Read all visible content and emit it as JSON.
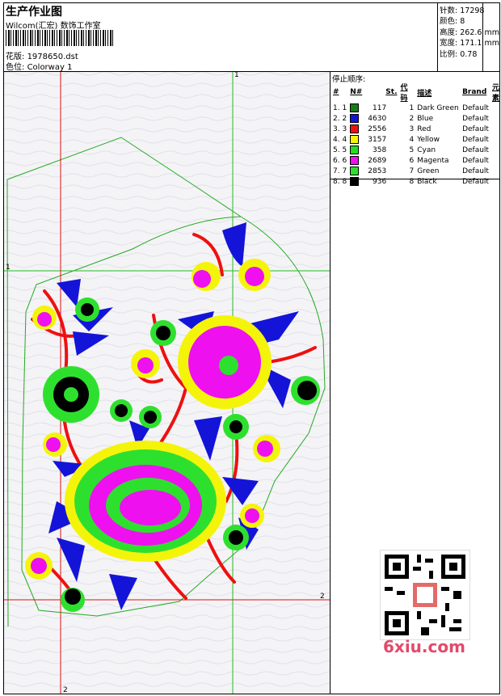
{
  "header": {
    "title": "生产作业图",
    "company": "Wilcom(汇宏) 数饰工作室",
    "design_label": "花版:",
    "design_value": "1978650.dst",
    "colorway_label": "色位:",
    "colorway_value": "Colorway 1"
  },
  "info": [
    {
      "label": "针数:",
      "value": "17298"
    },
    {
      "label": "颜色:",
      "value": "8"
    },
    {
      "label": "高度:",
      "value": "262.6 mm"
    },
    {
      "label": "宽度:",
      "value": "171.1 mm"
    },
    {
      "label": "比例:",
      "value": "0.78"
    }
  ],
  "stop_sequence": {
    "title": "停止顺序:",
    "headers": [
      "#",
      "N#",
      "St.",
      "代码",
      "描述",
      "Brand",
      "元素"
    ],
    "rows": [
      {
        "idx": "1. 1",
        "color": "#1a7a1a",
        "st": "117",
        "code": "1",
        "desc": "Dark Green",
        "brand": "Default"
      },
      {
        "idx": "2. 2",
        "color": "#1414d8",
        "st": "4630",
        "code": "2",
        "desc": "Blue",
        "brand": "Default"
      },
      {
        "idx": "3. 3",
        "color": "#ee1010",
        "st": "2556",
        "code": "3",
        "desc": "Red",
        "brand": "Default"
      },
      {
        "idx": "4. 4",
        "color": "#f4f40a",
        "st": "3157",
        "code": "4",
        "desc": "Yellow",
        "brand": "Default"
      },
      {
        "idx": "5. 5",
        "color": "#22dd22",
        "st": "358",
        "code": "5",
        "desc": "Cyan",
        "brand": "Default"
      },
      {
        "idx": "6. 6",
        "color": "#ee10ee",
        "st": "2689",
        "code": "6",
        "desc": "Magenta",
        "brand": "Default"
      },
      {
        "idx": "7. 7",
        "color": "#2ee02e",
        "st": "2853",
        "code": "7",
        "desc": "Green",
        "brand": "Default"
      },
      {
        "idx": "8. 8",
        "color": "#000000",
        "st": "936",
        "code": "8",
        "desc": "Black",
        "brand": "Default"
      }
    ]
  },
  "guides": {
    "label_1": "1",
    "label_2": "2"
  },
  "watermark": "6xiu.com",
  "colors": {
    "guide_green": "#22bb22",
    "guide_red": "#dd1111",
    "canvas_bg": "#f4f3f6"
  }
}
